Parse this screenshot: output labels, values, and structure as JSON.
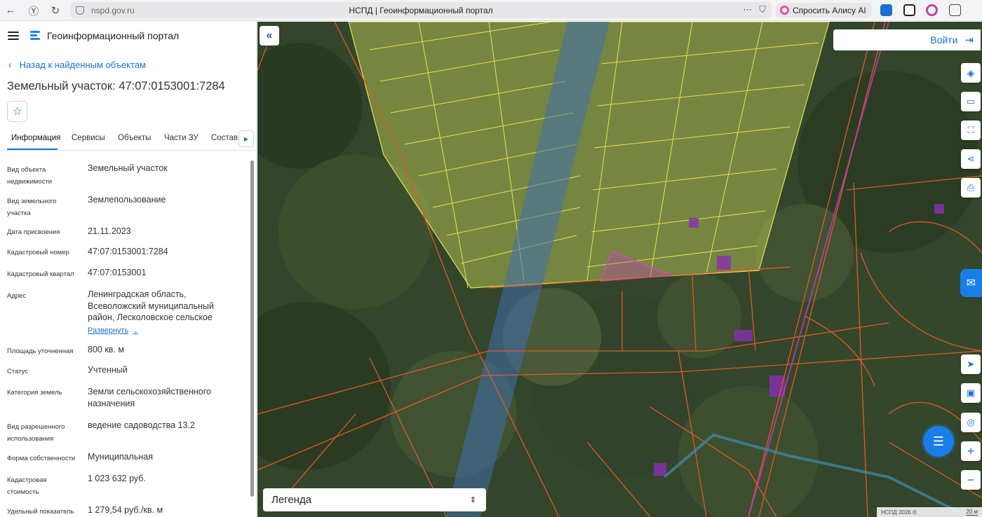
{
  "browser": {
    "url": "nspd.gov.ru",
    "tab_title": "НСПД | Геоинформационный портал",
    "alisa_label": "Спросить Алису AI"
  },
  "header": {
    "portal_title": "Геоинформационный портал"
  },
  "panel": {
    "back_link": "Назад к найденным объектам",
    "object_title": "Земельный участок: 47:07:0153001:7284",
    "tabs": [
      {
        "label": "Информация"
      },
      {
        "label": "Сервисы"
      },
      {
        "label": "Объекты"
      },
      {
        "label": "Части ЗУ"
      },
      {
        "label": "Состав"
      }
    ],
    "expand_label": "Развернуть",
    "attributes": [
      {
        "label": "Вид объекта недвижимости",
        "value": "Земельный участок"
      },
      {
        "label": "Вид земельного участка",
        "value": "Землепользование"
      },
      {
        "label": "Дата присвоения",
        "value": "21.11.2023"
      },
      {
        "label": "Кадастровый номер",
        "value": "47:07:0153001:7284"
      },
      {
        "label": "Кадастровый квартал",
        "value": "47:07:0153001"
      },
      {
        "label": "Адрес",
        "value": "Ленинградская область, Всеволожский муниципальный район, Лесколовское сельское"
      },
      {
        "label": "Площадь уточненная",
        "value": "800 кв. м"
      },
      {
        "label": "Статус",
        "value": "Учтенный"
      },
      {
        "label": "Категория земель",
        "value": "Земли сельскохозяйственного назначения"
      },
      {
        "label": "Вид разрешенного использования",
        "value": "ведение садоводства 13.2"
      },
      {
        "label": "Форма собственности",
        "value": "Муниципальная"
      },
      {
        "label": "Кадастровая стоимость",
        "value": "1 023 632 руб."
      },
      {
        "label": "Удельный показатель",
        "value": "1 279,54 руб./кв. м"
      }
    ]
  },
  "map": {
    "login_label": "Войти",
    "legend_label": "Легенда",
    "attribution": "НСПД 2026 ©",
    "scale_label": "20 м"
  },
  "colors": {
    "accent": "#1a6fd0",
    "parcel_line": "#e05a2b",
    "garden_fill": "#d9e36a",
    "river": "#3f6fae",
    "selected": "#c23bb8"
  }
}
